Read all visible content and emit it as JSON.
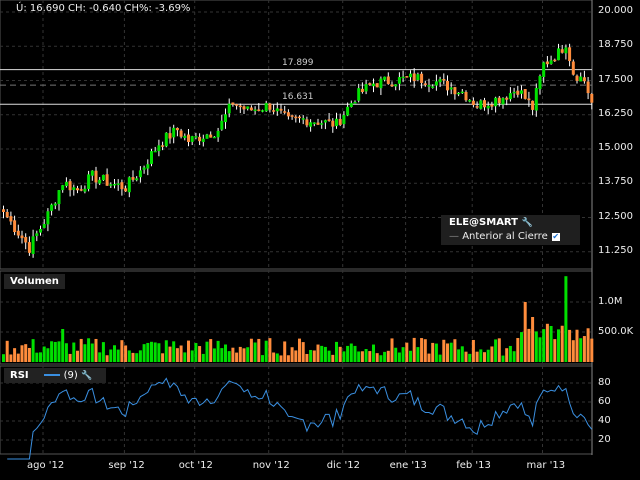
{
  "header": {
    "quote": "Ú: 16.690 CH: -0.640 CH%: -3.69%"
  },
  "legend": {
    "symbol": "ELE@SMART",
    "series_label": "Anterior al Cierre",
    "checked": true
  },
  "volume_panel": {
    "label": "Volumen",
    "ticks": [
      "1.0M",
      "500.0K"
    ]
  },
  "rsi_panel": {
    "label": "RSI",
    "period": "(9)",
    "ticks": [
      "80",
      "60",
      "40",
      "20"
    ]
  },
  "price_lines": {
    "upper": "17.899",
    "lower": "16.631"
  },
  "colors": {
    "up": "#00e000",
    "down": "#ff8c3c",
    "rsi": "#3a8fe0",
    "bg": "#000000"
  },
  "chart_data": {
    "type": "candlestick",
    "price_ticks": [
      "20.000",
      "18.750",
      "17.500",
      "16.250",
      "15.000",
      "13.750",
      "12.500",
      "11.250"
    ],
    "ylim": [
      10.75,
      20.4
    ],
    "x_labels": [
      "ago '12",
      "sep '12",
      "oct '12",
      "nov '12",
      "dic '12",
      "ene '13",
      "feb '13",
      "mar '13"
    ],
    "x_label_days": [
      10,
      32,
      51,
      71,
      91,
      108,
      126,
      145
    ],
    "previous_close": 17.33,
    "horizontal_lines": [
      17.899,
      16.631
    ],
    "close_anchors": [
      [
        0,
        12.7
      ],
      [
        7,
        11.4
      ],
      [
        12,
        12.6
      ],
      [
        16,
        13.8
      ],
      [
        20,
        13.5
      ],
      [
        24,
        14.0
      ],
      [
        30,
        13.7
      ],
      [
        33,
        13.6
      ],
      [
        37,
        14.2
      ],
      [
        42,
        15.2
      ],
      [
        47,
        15.7
      ],
      [
        50,
        15.3
      ],
      [
        54,
        15.5
      ],
      [
        58,
        15.7
      ],
      [
        62,
        16.7
      ],
      [
        66,
        16.4
      ],
      [
        72,
        16.6
      ],
      [
        77,
        16.0
      ],
      [
        81,
        16.1
      ],
      [
        90,
        15.9
      ],
      [
        95,
        16.9
      ],
      [
        100,
        17.4
      ],
      [
        105,
        17.5
      ],
      [
        111,
        17.6
      ],
      [
        116,
        17.5
      ],
      [
        124,
        17.1
      ],
      [
        128,
        16.6
      ],
      [
        135,
        16.9
      ],
      [
        139,
        17.2
      ],
      [
        143,
        16.5
      ],
      [
        146,
        18.1
      ],
      [
        150,
        18.5
      ],
      [
        152,
        18.9
      ],
      [
        154,
        17.8
      ],
      [
        157,
        17.5
      ],
      [
        159,
        16.69
      ]
    ],
    "volume_spikes": [
      [
        141,
        1.0
      ],
      [
        143,
        0.75
      ],
      [
        152,
        1.43
      ],
      [
        148,
        0.6
      ],
      [
        16,
        0.55
      ]
    ],
    "volume_typical": 0.3
  }
}
